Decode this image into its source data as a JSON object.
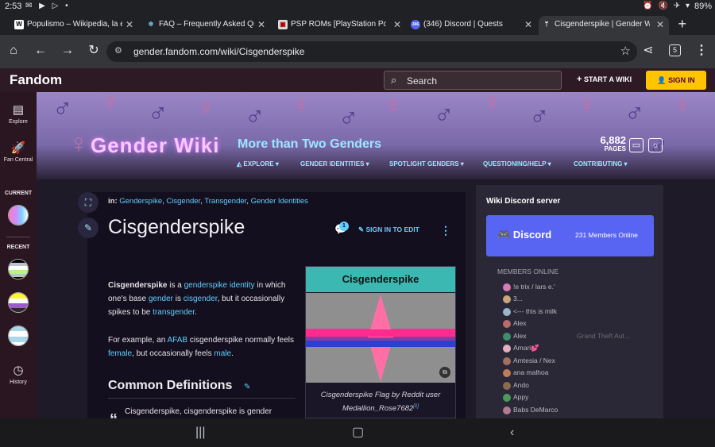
{
  "status_bar": {
    "time": "2:53",
    "left_icons": [
      "mail-icon",
      "youtube-icon",
      "play-icon",
      "dot-icon"
    ],
    "battery": "89%"
  },
  "tabs": [
    {
      "title": "Populismo – Wikipedia, la enciclopedia",
      "favicon": "W",
      "active": false
    },
    {
      "title": "FAQ – Frequently Asked Questions",
      "favicon": "✲",
      "active": false
    },
    {
      "title": "PSP ROMs [PlayStation Portable]",
      "favicon": "▣",
      "active": false
    },
    {
      "title": "(346) Discord | Quests",
      "favicon": "346",
      "active": false
    },
    {
      "title": "Cisgenderspike | Gender Wiki",
      "favicon": "ᛘ",
      "active": true
    }
  ],
  "browser": {
    "url": "gender.fandom.com/wiki/Cisgenderspike",
    "tab_count": "5"
  },
  "fandom_bar": {
    "logo": "Fandom",
    "search_placeholder": "Search",
    "start_wiki": "START A WIKI",
    "sign_in": "SIGN IN"
  },
  "rail": {
    "explore": "Explore",
    "fan_central": "Fan Central",
    "current": "CURRENT",
    "recent": "RECENT",
    "history": "History"
  },
  "banner": {
    "wiki_title": "Gender Wiki",
    "tagline": "More than Two Genders",
    "page_count": "6,882",
    "page_count_label": "PAGES",
    "nav": [
      "EXPLORE",
      "GENDER IDENTITIES",
      "SPOTLIGHT GENDERS",
      "QUESTIONING/HELP",
      "CONTRIBUTING"
    ]
  },
  "article": {
    "breadcrumb_prefix": "in:",
    "categories": [
      "Genderspike",
      "Cisgender",
      "Transgender",
      "Gender Identities"
    ],
    "title": "Cisgenderspike",
    "comment_count": "1",
    "edit_label": "SIGN IN TO EDIT",
    "p1": {
      "bold": "Cisgenderspike",
      "t1": " is a ",
      "l1": "genderspike",
      "t2": " ",
      "l2": "identity",
      "t3": " in which one's base ",
      "l3": "gender",
      "t4": " is ",
      "l4": "cisgender",
      "t5": ", but it occasionally spikes to be ",
      "l5": "transgender",
      "t6": "."
    },
    "p2": {
      "t1": "For example, an ",
      "l1": "AFAB",
      "t2": " cisgenderspike normally feels ",
      "l2": "female",
      "t3": ", but occasionally feels ",
      "l3": "male",
      "t4": "."
    },
    "section_heading": "Common Definitions",
    "quote_start": "Cisgenderspike, cisgenderspike is gender"
  },
  "infobox": {
    "title": "Cisgenderspike",
    "caption": "Cisgenderspike Flag by Reddit user Medallion_Rose7682",
    "ref": "[1]"
  },
  "discord": {
    "heading": "Wiki Discord server",
    "logo": "Discord",
    "online": "231 Members Online",
    "members_label": "MEMBERS ONLINE",
    "members": [
      {
        "name": "!e trix / lars e.'",
        "game": ""
      },
      {
        "name": "3...",
        "game": ""
      },
      {
        "name": "<--- this is milk",
        "game": ""
      },
      {
        "name": "Alex",
        "game": ""
      },
      {
        "name": "Alex",
        "game": "Grand Theft Aut..."
      },
      {
        "name": "Amari💕",
        "game": ""
      },
      {
        "name": "Amtesia / Nex",
        "game": ""
      },
      {
        "name": "ana malhoa",
        "game": ""
      },
      {
        "name": "Ando",
        "game": ""
      },
      {
        "name": "Appy",
        "game": ""
      },
      {
        "name": "Babs DeMarco",
        "game": ""
      }
    ]
  },
  "colors": {
    "fandom_bar": "#2e1a24",
    "sign_in_bg": "#ffc500",
    "link": "#5fd0ff",
    "infobox_title": "#3cb8b2",
    "discord": "#5865f2"
  }
}
